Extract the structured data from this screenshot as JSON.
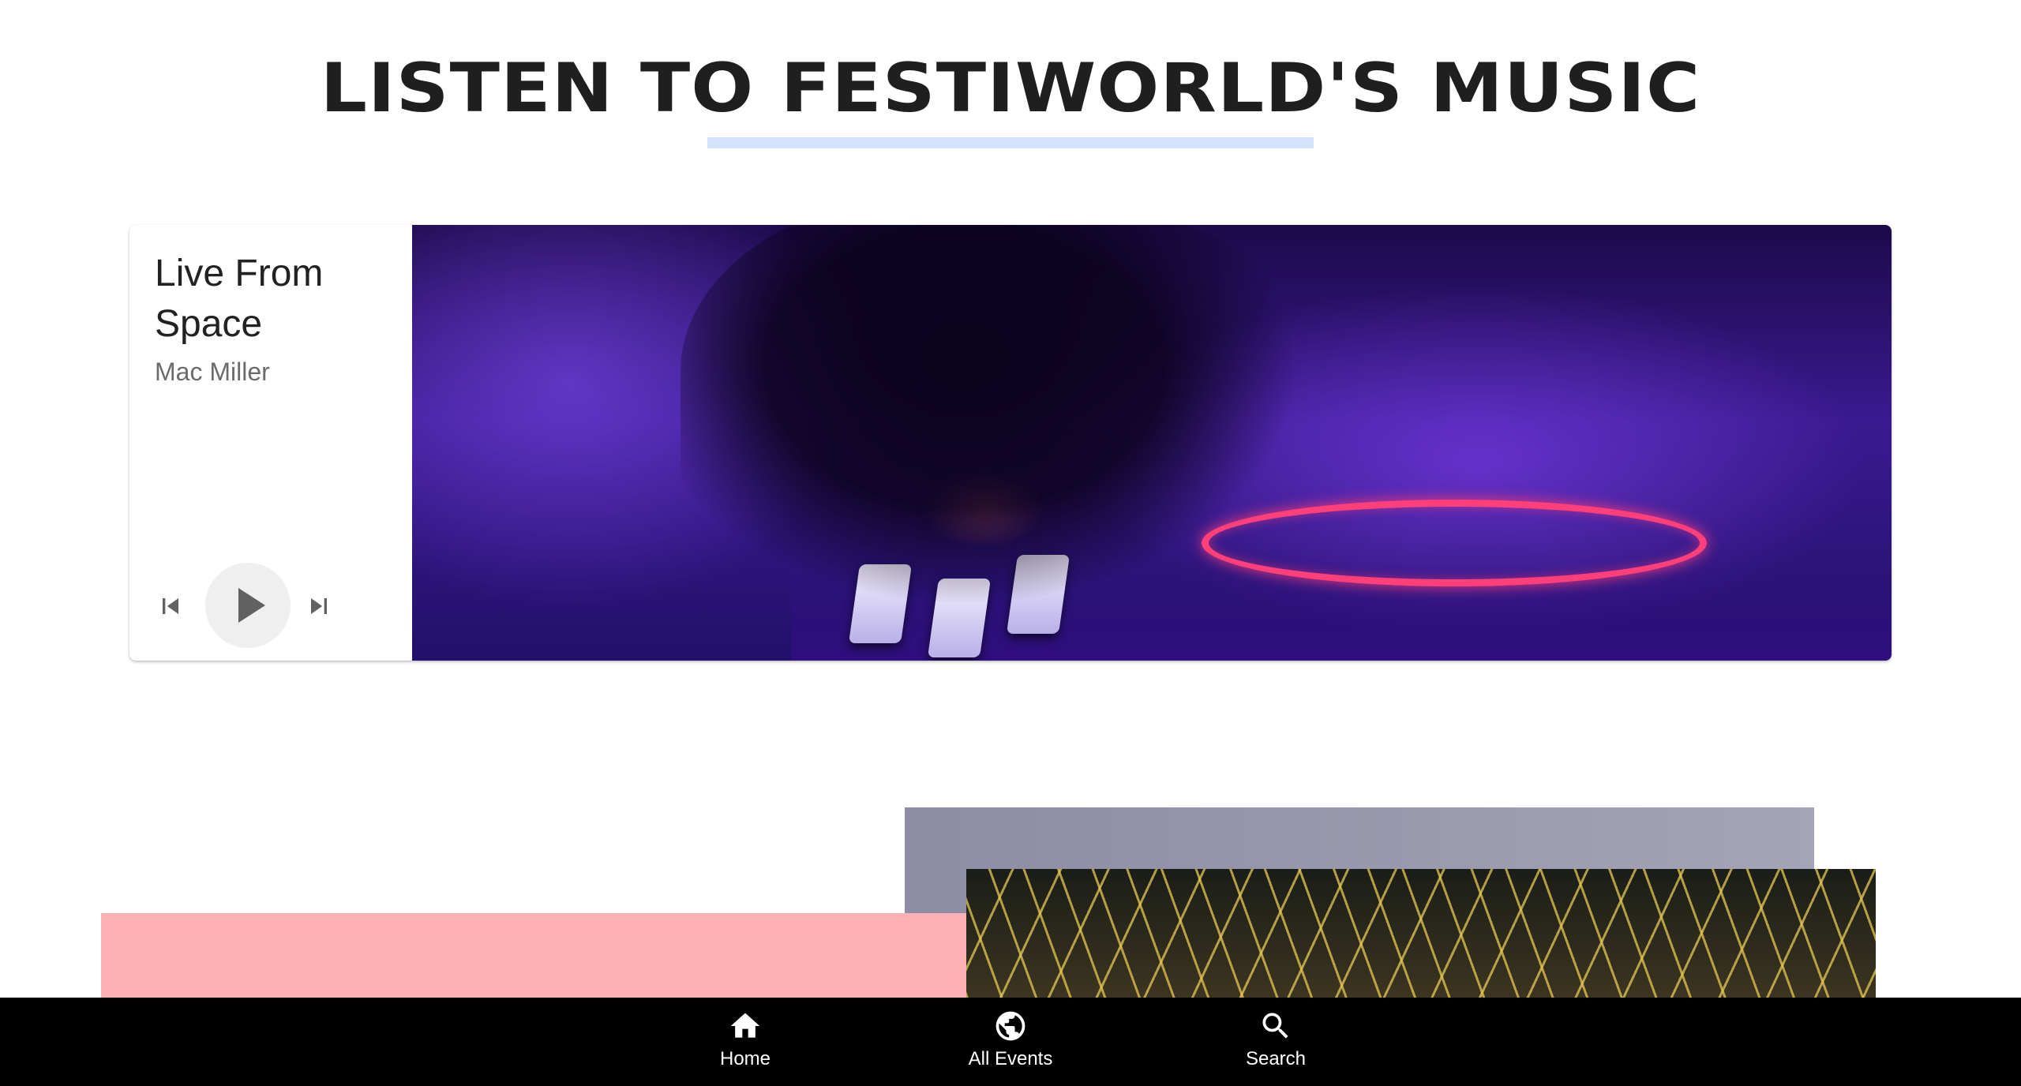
{
  "page": {
    "title": "LISTEN TO FESTIWORLD'S MUSIC"
  },
  "player": {
    "track_title": "Live From Space",
    "artist": "Mac Miller",
    "album_art_icon": "dj-turntable-image"
  },
  "bottom_nav": {
    "items": [
      {
        "label": "Home",
        "icon": "home-icon"
      },
      {
        "label": "All Events",
        "icon": "globe-icon"
      },
      {
        "label": "Search",
        "icon": "search-icon"
      }
    ]
  },
  "colors": {
    "title": "#1f1f1f",
    "underline": "#d3e3fb",
    "pink_block": "#fdb0b1",
    "gray_block": "#9b99ad",
    "nav_background": "#000000"
  }
}
